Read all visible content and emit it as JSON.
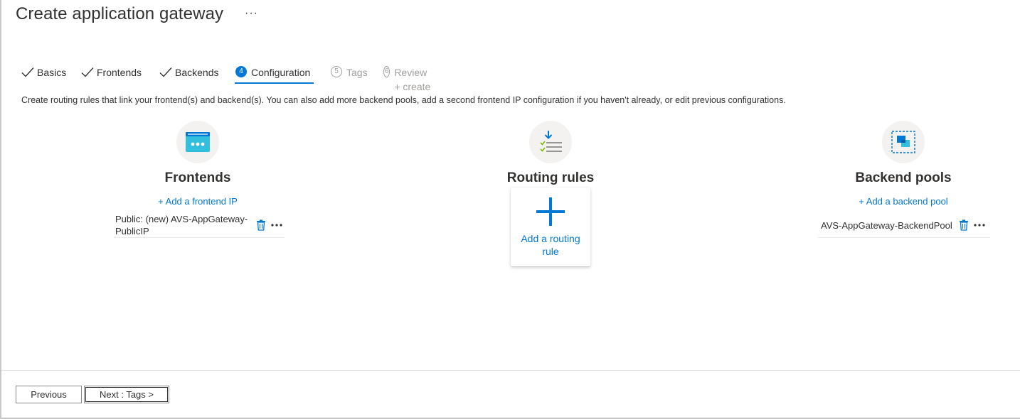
{
  "page": {
    "title": "Create application gateway",
    "more_label": "···"
  },
  "tabs": [
    {
      "label": "Basics",
      "state": "completed"
    },
    {
      "label": "Frontends",
      "state": "completed"
    },
    {
      "label": "Backends",
      "state": "completed"
    },
    {
      "label": "Configuration",
      "state": "active",
      "number": "4"
    },
    {
      "label": "Tags",
      "state": "disabled",
      "number": "5"
    },
    {
      "label": "Review + create",
      "state": "disabled",
      "number": "6"
    }
  ],
  "description": "Create routing rules that link your frontend(s) and backend(s). You can also add more backend pools, add a second frontend IP configuration if you haven't already, or edit previous configurations.",
  "frontends": {
    "heading": "Frontends",
    "add_link": "+ Add a frontend IP",
    "items": [
      {
        "line1": "Public: (new) AVS-AppGateway-",
        "line2": "PublicIP"
      }
    ]
  },
  "routing_rules": {
    "heading": "Routing rules",
    "add_card_label": "Add a routing rule"
  },
  "backend_pools": {
    "heading": "Backend pools",
    "add_link": "+ Add a backend pool",
    "items": [
      {
        "label": "AVS-AppGateway-BackendPool"
      }
    ]
  },
  "footer": {
    "previous_label": "Previous",
    "next_label": "Next : Tags >"
  },
  "colors": {
    "accent": "#0078d4",
    "text": "#323130",
    "disabled": "#a19f9d",
    "icon_bg": "#f3f2f1"
  },
  "icons": {
    "frontends": "frontend-ip-icon",
    "routing_rules": "routing-rules-icon",
    "backend_pools": "backend-pool-icon",
    "delete": "trash-icon",
    "more": "more-icon",
    "completed_tab": "checkmark-icon"
  }
}
